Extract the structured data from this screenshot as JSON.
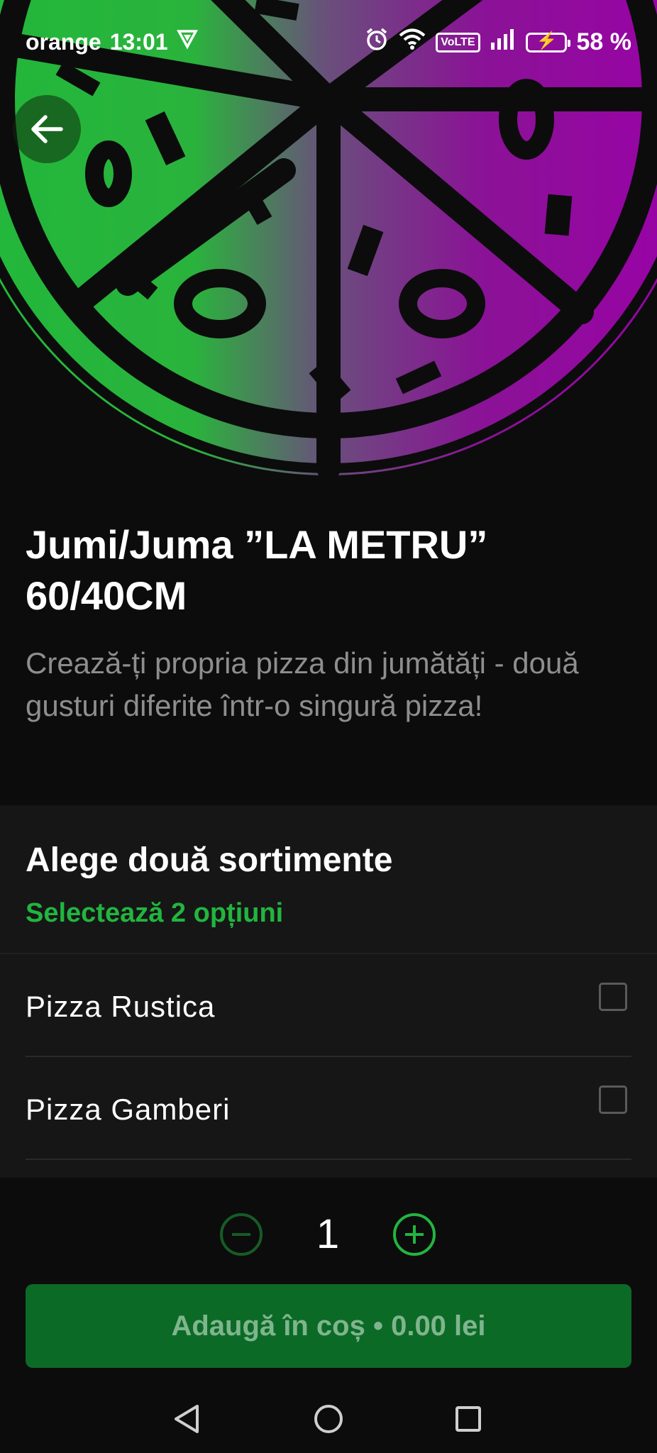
{
  "status_bar": {
    "carrier": "orange",
    "time": "13:01",
    "network": "VoLTE",
    "battery": "58 %"
  },
  "product": {
    "title": "Jumi/Juma ”LA METRU” 60/40CM",
    "description": "Crează-ți propria pizza din jumătăți - două gusturi diferite într-o singură pizza!"
  },
  "options": {
    "title": "Alege două sortimente",
    "subtitle": "Selectează 2 opțiuni",
    "items": [
      {
        "label": "Pizza Rustica",
        "checked": false
      },
      {
        "label": "Pizza Gamberi",
        "checked": false
      }
    ]
  },
  "quantity": {
    "value": "1"
  },
  "cart_button": {
    "label": "Adaugă în coș • 0.00 lei"
  },
  "colors": {
    "accent_green": "#22b53f",
    "button_green": "#0c6a27",
    "pizza_purple": "#8e0a9a",
    "background": "#0c0c0c"
  },
  "icons": [
    "back-arrow-icon",
    "alarm-icon",
    "wifi-icon",
    "signal-icon",
    "battery-icon",
    "minus-icon",
    "plus-icon",
    "nav-back-icon",
    "nav-home-icon",
    "nav-recents-icon"
  ]
}
